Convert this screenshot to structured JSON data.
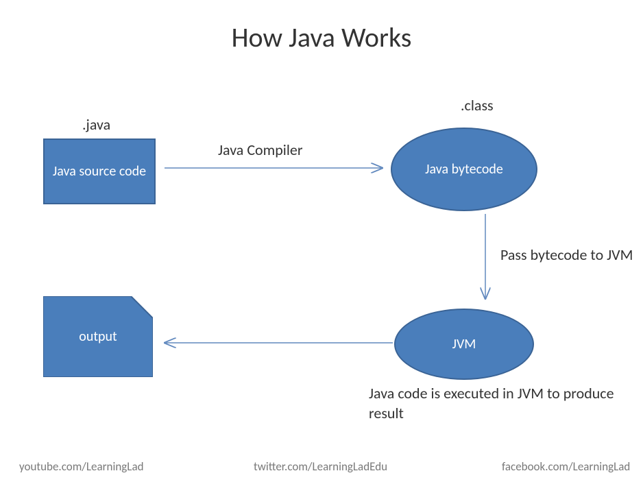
{
  "title": "How Java Works",
  "nodes": {
    "source": {
      "label": "Java source code",
      "ext": ".java"
    },
    "bytecode": {
      "label": "Java bytecode",
      "ext": ".class"
    },
    "jvm": {
      "label": "JVM"
    },
    "output": {
      "label": "output"
    }
  },
  "edges": {
    "compiler": "Java Compiler",
    "pass": "Pass bytecode to JVM",
    "execute": "Java code is executed in JVM to produce result"
  },
  "footer": {
    "youtube": "youtube.com/LearningLad",
    "twitter": "twitter.com/LearningLadEdu",
    "facebook": "facebook.com/LearningLad"
  },
  "colors": {
    "shape_fill": "#4a7ebb",
    "shape_stroke": "#3a6395",
    "arrow": "#6088be",
    "footer_text": "#797979"
  }
}
